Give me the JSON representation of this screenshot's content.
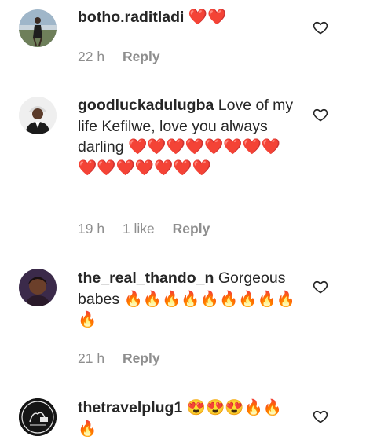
{
  "comments": [
    {
      "username": "botho.raditladi",
      "text": "❤️❤️",
      "time": "22 h",
      "likes": "",
      "reply_label": "Reply",
      "avatar_icon": "avatar-photo"
    },
    {
      "username": "goodluckadulugba",
      "text": "Love of my life Kefilwe, love you always darling ❤️❤️❤️❤️❤️❤️❤️❤️❤️❤️❤️❤️❤️❤️❤️",
      "time": "19 h",
      "likes": "1 like",
      "reply_label": "Reply",
      "avatar_icon": "avatar-photo"
    },
    {
      "username": "the_real_thando_n",
      "text": "Gorgeous babes 🔥🔥🔥🔥🔥🔥🔥🔥🔥🔥",
      "time": "21 h",
      "likes": "",
      "reply_label": "Reply",
      "avatar_icon": "avatar-photo"
    },
    {
      "username": "thetravelplug1",
      "text": "😍😍😍🔥🔥🔥",
      "time": "",
      "likes": "",
      "reply_label": "",
      "avatar_icon": "avatar-logo"
    }
  ],
  "icons": {
    "like": "heart-outline-icon"
  },
  "colors": {
    "text": "#262626",
    "meta": "#8e8e8e",
    "background": "#ffffff"
  }
}
